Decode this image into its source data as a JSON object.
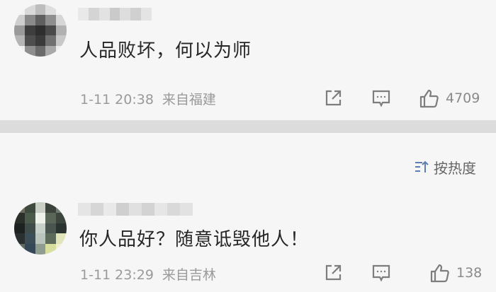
{
  "comments": [
    {
      "text": "人品败坏，何以为师",
      "time": "1-11 20:38",
      "region": "来自福建",
      "likes": "4709",
      "avatar_icon": "pixelated-avatar"
    },
    {
      "text": "你人品好？随意诋毁他人！",
      "time": "1-11 23:29",
      "region": "来自吉林",
      "likes": "138",
      "avatar_icon": "pixelated-avatar"
    }
  ],
  "sort": {
    "label": "按热度",
    "icon": "sort-icon"
  },
  "icons": {
    "share": "share-icon",
    "reply": "comment-icon",
    "like": "thumbs-up-icon"
  },
  "colors": {
    "background": "#f6f6f6",
    "divider": "#dcdcdc",
    "meta_text": "#9a9a9a",
    "icon": "#7d7d7d"
  }
}
